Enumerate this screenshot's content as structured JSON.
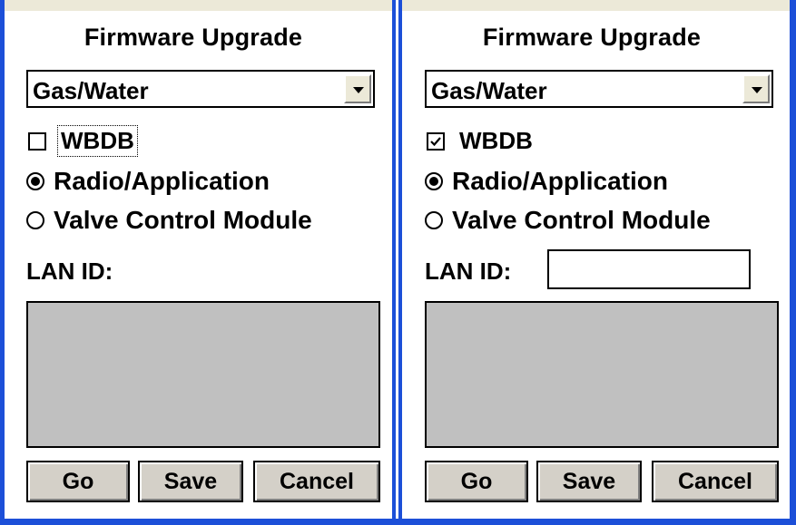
{
  "panels": [
    {
      "title": "Firmware Upgrade",
      "device_type": {
        "selected": "Gas/Water"
      },
      "wbdb": {
        "label": "WBDB",
        "checked": false
      },
      "radios": [
        {
          "label": "Radio/Application",
          "selected": true
        },
        {
          "label": "Valve Control Module",
          "selected": false
        }
      ],
      "lan_id": {
        "label": "LAN ID:",
        "value": "",
        "input_visible": false
      },
      "buttons": {
        "go": "Go",
        "save": "Save",
        "cancel": "Cancel"
      }
    },
    {
      "title": "Firmware Upgrade",
      "device_type": {
        "selected": "Gas/Water"
      },
      "wbdb": {
        "label": "WBDB",
        "checked": true
      },
      "radios": [
        {
          "label": "Radio/Application",
          "selected": true
        },
        {
          "label": "Valve Control Module",
          "selected": false
        }
      ],
      "lan_id": {
        "label": "LAN ID:",
        "value": "",
        "input_visible": true
      },
      "buttons": {
        "go": "Go",
        "save": "Save",
        "cancel": "Cancel"
      }
    }
  ],
  "icons": {
    "dropdown": "chevron-down-icon",
    "checkbox_checked": "checkmark-icon"
  },
  "colors": {
    "window_border": "#1c4fd8",
    "list_background": "#c0c0c0",
    "button_face": "#d4d0c8"
  }
}
